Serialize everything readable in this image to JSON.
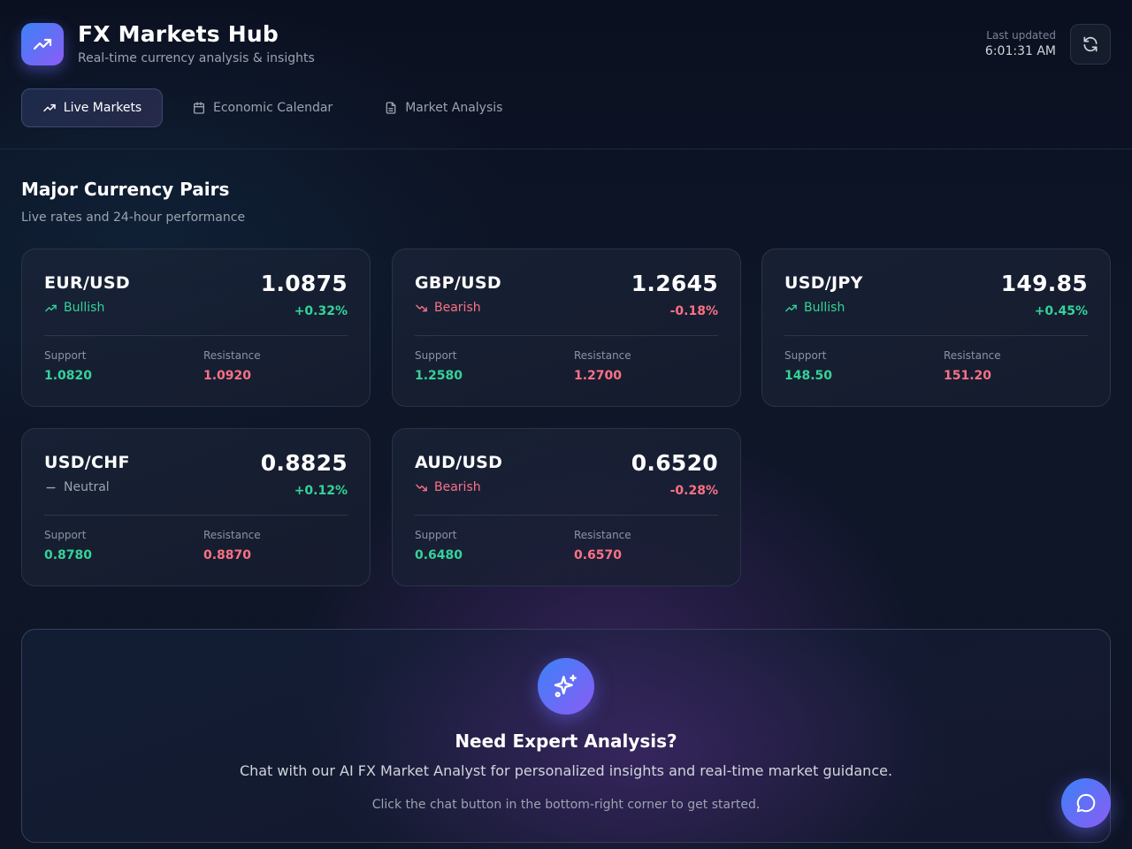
{
  "app": {
    "title": "FX Markets Hub",
    "subtitle": "Real-time currency analysis & insights",
    "logo_icon": "trending-up-icon"
  },
  "header": {
    "updated_label": "Last updated",
    "updated_time": "6:01:31 AM",
    "refresh_icon": "refresh-icon"
  },
  "tabs": [
    {
      "label": "Live Markets",
      "icon": "trending-up-icon",
      "active": true
    },
    {
      "label": "Economic Calendar",
      "icon": "calendar-icon",
      "active": false
    },
    {
      "label": "Market Analysis",
      "icon": "document-icon",
      "active": false
    }
  ],
  "section": {
    "title": "Major Currency Pairs",
    "subtitle": "Live rates and 24-hour performance"
  },
  "labels": {
    "support": "Support",
    "resistance": "Resistance"
  },
  "pairs": [
    {
      "pair": "EUR/USD",
      "trend": "Bullish",
      "rate": "1.0875",
      "change": "+0.32%",
      "support": "1.0820",
      "resistance": "1.0920"
    },
    {
      "pair": "GBP/USD",
      "trend": "Bearish",
      "rate": "1.2645",
      "change": "-0.18%",
      "support": "1.2580",
      "resistance": "1.2700"
    },
    {
      "pair": "USD/JPY",
      "trend": "Bullish",
      "rate": "149.85",
      "change": "+0.45%",
      "support": "148.50",
      "resistance": "151.20"
    },
    {
      "pair": "USD/CHF",
      "trend": "Neutral",
      "rate": "0.8825",
      "change": "+0.12%",
      "support": "0.8780",
      "resistance": "0.8870"
    },
    {
      "pair": "AUD/USD",
      "trend": "Bearish",
      "rate": "0.6520",
      "change": "-0.28%",
      "support": "0.6480",
      "resistance": "0.6570"
    }
  ],
  "cta": {
    "icon": "sparkles-icon",
    "title": "Need Expert Analysis?",
    "text": "Chat with our AI FX Market Analyst for personalized insights and real-time market guidance.",
    "hint": "Click the chat button in the bottom-right corner to get started."
  },
  "chat": {
    "icon": "chat-bubble-icon"
  },
  "colors": {
    "bullish": "#34d399",
    "bearish": "#fb7185",
    "neutral": "#9ca3af",
    "accent_start": "#3b82f6",
    "accent_end": "#8b5cf6"
  }
}
